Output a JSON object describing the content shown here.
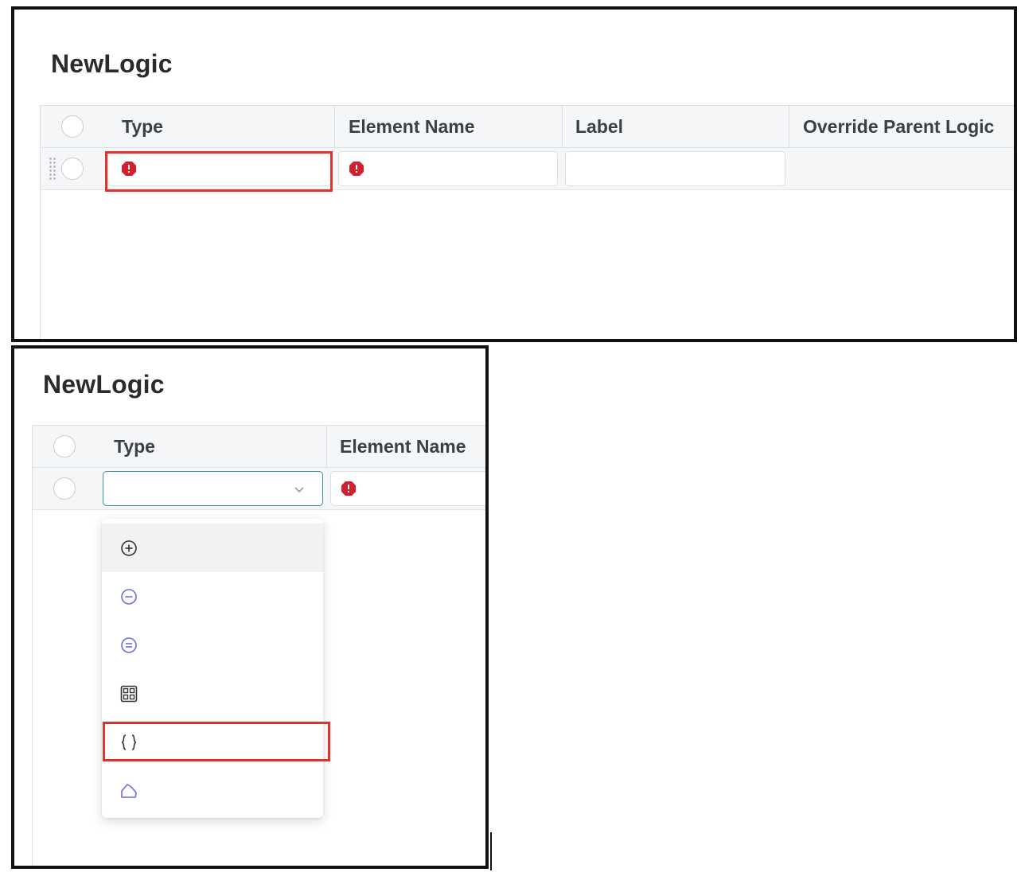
{
  "top_panel": {
    "title": "NewLogic",
    "columns": [
      "Type",
      "Element Name",
      "Label",
      "Override Parent Logic"
    ],
    "row": {
      "type": "",
      "element_name": "",
      "label": ""
    }
  },
  "bottom_panel": {
    "title": "NewLogic",
    "columns": [
      "Type",
      "Element Name"
    ],
    "type_select": {
      "value": ""
    },
    "dropdown_items": [
      {
        "icon": "plus-circle-icon"
      },
      {
        "icon": "minus-circle-icon"
      },
      {
        "icon": "equals-circle-icon"
      },
      {
        "icon": "grid-table-icon"
      },
      {
        "icon": "curly-braces-icon"
      },
      {
        "icon": "shape-outline-icon"
      }
    ]
  },
  "colors": {
    "error_red": "#d3202f",
    "highlight_red": "#e0332b",
    "focus_teal": "#3b8fa3",
    "icon_purple": "#6b6ce6"
  }
}
